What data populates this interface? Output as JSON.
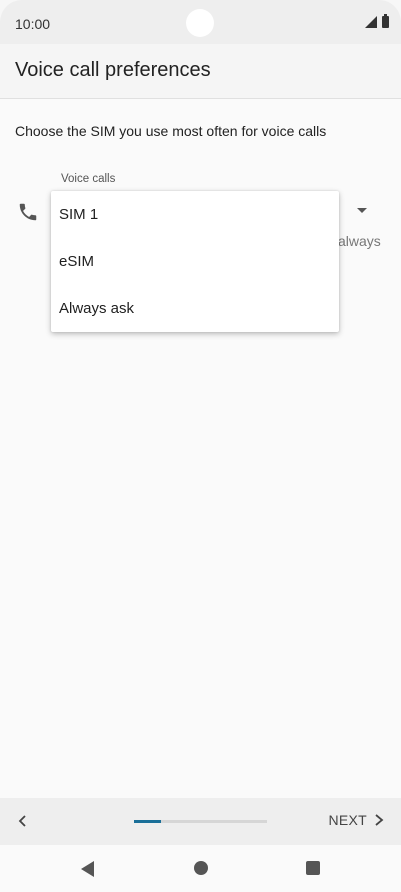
{
  "status_bar": {
    "time": "10:00"
  },
  "header": {
    "title": "Voice call preferences"
  },
  "main": {
    "description": "Choose the SIM you use most often for voice calls",
    "voice_calls_label": "Voice calls",
    "partial_text": "always"
  },
  "menu": {
    "items": [
      {
        "label": "SIM 1"
      },
      {
        "label": "eSIM"
      },
      {
        "label": "Always ask"
      }
    ]
  },
  "setup_bar": {
    "next_label": "NEXT",
    "progress_fraction": 0.2,
    "accent_color": "#1a6f98"
  },
  "icons": {
    "phone": "phone-icon",
    "dropdown": "dropdown-arrow-icon",
    "back": "chevron-left-icon",
    "next": "chevron-right-icon"
  }
}
